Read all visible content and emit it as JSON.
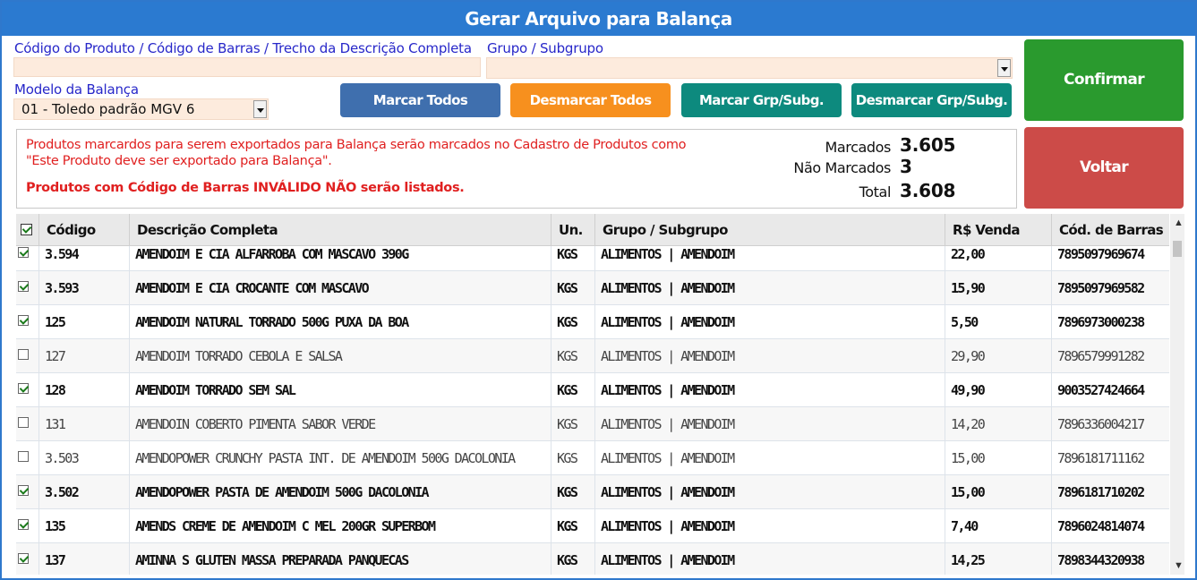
{
  "window": {
    "title": "Gerar Arquivo para Balança"
  },
  "form": {
    "search_label": "Código do Produto / Código de Barras / Trecho da Descrição Completa",
    "search_value": "",
    "group_label": "Grupo / Subgrupo",
    "group_value": "",
    "scale_label": "Modelo da Balança",
    "scale_value": "01 - Toledo padrão MGV 6"
  },
  "buttons": {
    "mark_all": "Marcar Todos",
    "unmark_all": "Desmarcar Todos",
    "mark_group": "Marcar Grp/Subg.",
    "unmark_group": "Desmarcar Grp/Subg.",
    "confirm": "Confirmar",
    "back": "Voltar"
  },
  "info": {
    "line1": "Produtos marcardos para serem exportados para Balança serão marcados no Cadastro de Produtos como",
    "line2": "\"Este Produto deve ser exportado para Balança\".",
    "line3": "Produtos com Código de Barras INVÁLIDO NÃO serão listados.",
    "marked_label": "Marcados",
    "marked_value": "3.605",
    "unmarked_label": "Não Marcados",
    "unmarked_value": "3",
    "total_label": "Total",
    "total_value": "3.608"
  },
  "table": {
    "headers": {
      "code": "Código",
      "desc": "Descrição Completa",
      "unit": "Un.",
      "group": "Grupo / Subgrupo",
      "price": "R$ Venda",
      "barcode": "Cód. de Barras"
    },
    "rows": [
      {
        "checked": true,
        "code": "3.594",
        "desc": "AMENDOIM E CIA ALFARROBA COM MASCAVO 390G",
        "unit": "KGS",
        "group": "ALIMENTOS | AMENDOIM",
        "price": "22,00",
        "barcode": "7895097969674"
      },
      {
        "checked": true,
        "code": "3.593",
        "desc": "AMENDOIM E CIA CROCANTE COM MASCAVO",
        "unit": "KGS",
        "group": "ALIMENTOS | AMENDOIM",
        "price": "15,90",
        "barcode": "7895097969582"
      },
      {
        "checked": true,
        "code": "125",
        "desc": "AMENDOIM NATURAL TORRADO 500G PUXA DA BOA",
        "unit": "KGS",
        "group": "ALIMENTOS | AMENDOIM",
        "price": "5,50",
        "barcode": "7896973000238"
      },
      {
        "checked": false,
        "code": "127",
        "desc": "AMENDOIM TORRADO CEBOLA E SALSA",
        "unit": "KGS",
        "group": "ALIMENTOS | AMENDOIM",
        "price": "29,90",
        "barcode": "7896579991282"
      },
      {
        "checked": true,
        "code": "128",
        "desc": "AMENDOIM TORRADO SEM SAL",
        "unit": "KGS",
        "group": "ALIMENTOS | AMENDOIM",
        "price": "49,90",
        "barcode": "9003527424664"
      },
      {
        "checked": false,
        "code": "131",
        "desc": "AMENDOIN COBERTO PIMENTA SABOR VERDE",
        "unit": "KGS",
        "group": "ALIMENTOS | AMENDOIM",
        "price": "14,20",
        "barcode": "7896336004217"
      },
      {
        "checked": false,
        "code": "3.503",
        "desc": "AMENDOPOWER CRUNCHY PASTA INT. DE AMENDOIM 500G DACOLONIA",
        "unit": "KGS",
        "group": "ALIMENTOS | AMENDOIM",
        "price": "15,00",
        "barcode": "7896181711162"
      },
      {
        "checked": true,
        "code": "3.502",
        "desc": "AMENDOPOWER PASTA DE AMENDOIM 500G DACOLONIA",
        "unit": "KGS",
        "group": "ALIMENTOS | AMENDOIM",
        "price": "15,00",
        "barcode": "7896181710202"
      },
      {
        "checked": true,
        "code": "135",
        "desc": "AMENDS CREME DE AMENDOIM C MEL 200GR SUPERBOM",
        "unit": "KGS",
        "group": "ALIMENTOS | AMENDOIM",
        "price": "7,40",
        "barcode": "7896024814074"
      },
      {
        "checked": true,
        "code": "137",
        "desc": "AMINNA S GLUTEN MASSA PREPARADA PANQUECAS",
        "unit": "KGS",
        "group": "ALIMENTOS | AMENDOIM",
        "price": "14,25",
        "barcode": "7898344320938"
      }
    ]
  },
  "scrollbar": {
    "up_icon": "▲",
    "down_icon": "▼"
  }
}
